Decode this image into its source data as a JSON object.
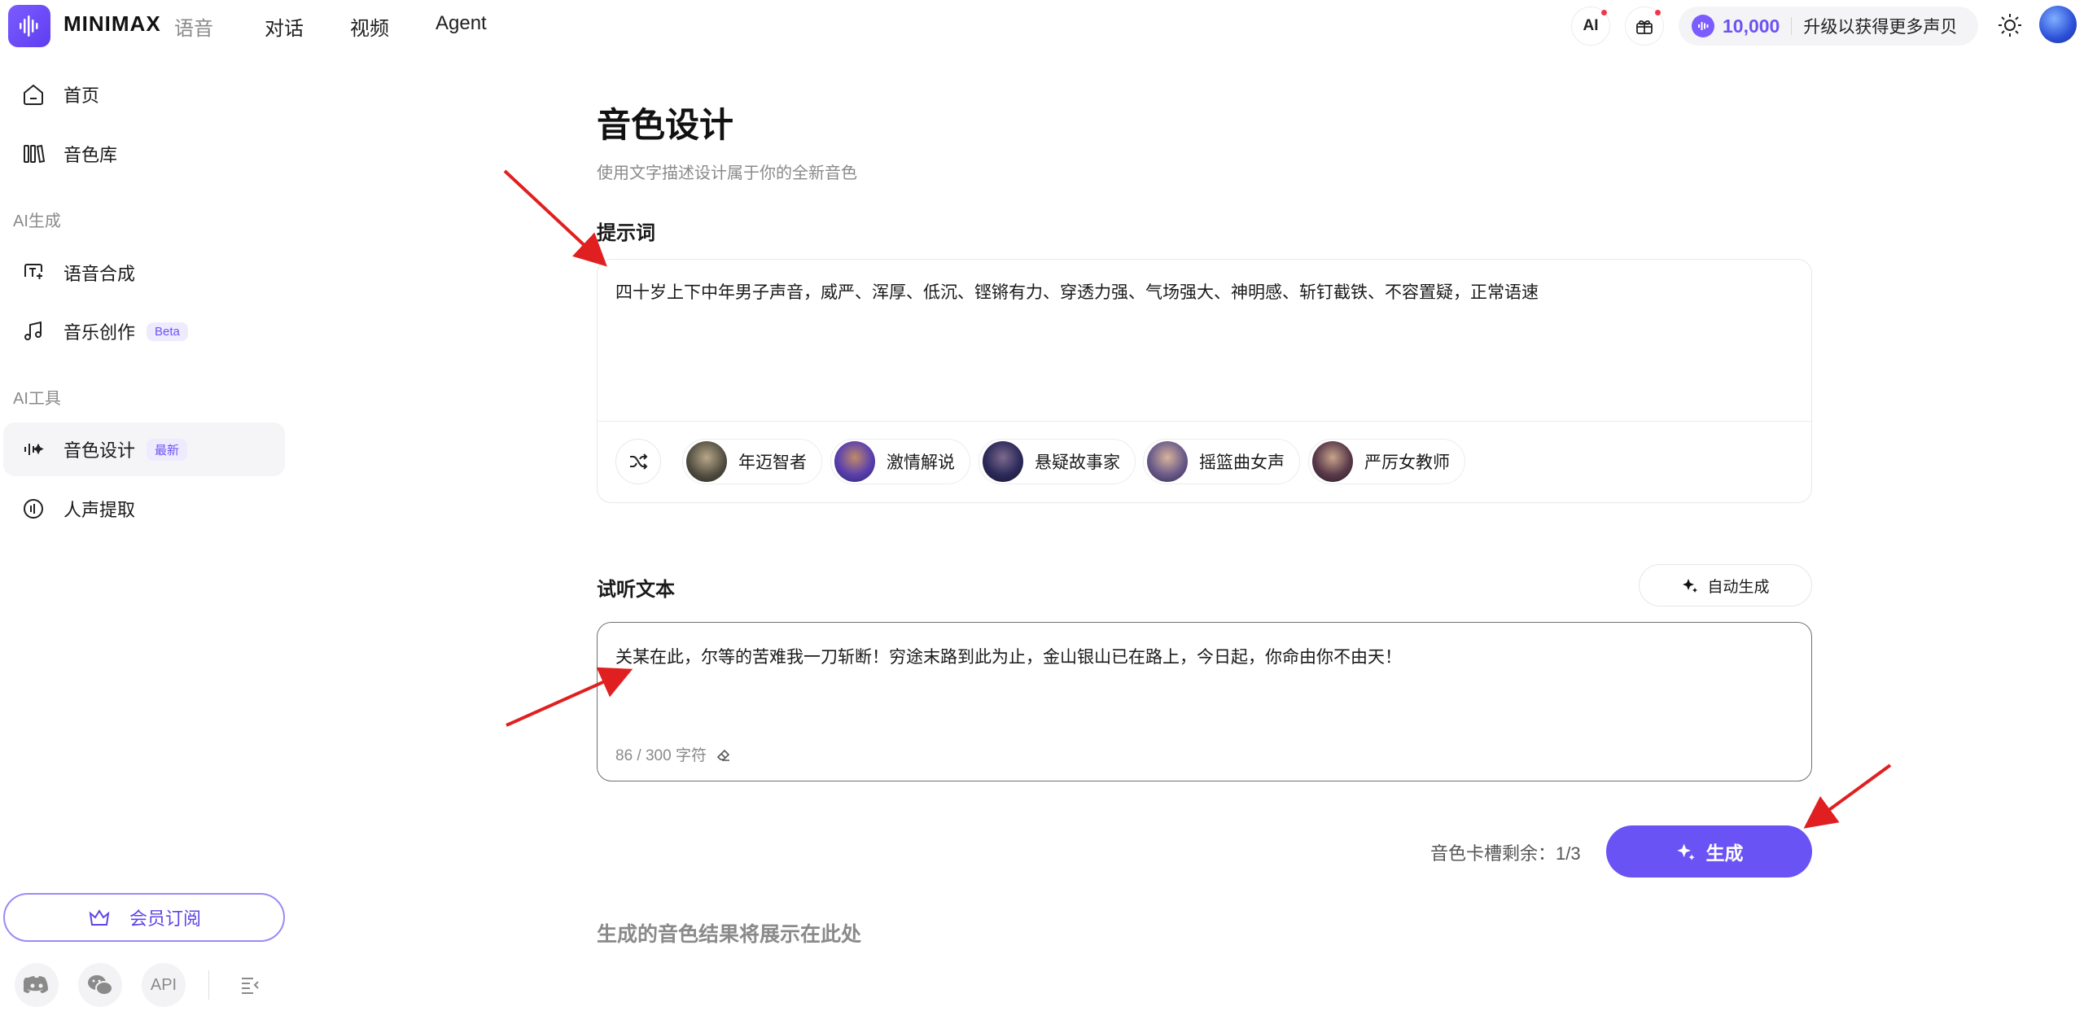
{
  "brand": {
    "name": "MINIMAX",
    "section": "语音"
  },
  "topnav": [
    "对话",
    "视频",
    "Agent"
  ],
  "header": {
    "ai_badge": "AI",
    "credits": "10,000",
    "upgrade": "升级以获得更多声贝"
  },
  "sidebar": {
    "items": [
      {
        "label": "首页",
        "icon": "home-icon"
      },
      {
        "label": "音色库",
        "icon": "library-icon"
      }
    ],
    "section_gen": "AI生成",
    "gen_items": [
      {
        "label": "语音合成",
        "icon": "tts-icon"
      },
      {
        "label": "音乐创作",
        "icon": "music-note-icon",
        "tag": "Beta"
      }
    ],
    "section_tools": "AI工具",
    "tool_items": [
      {
        "label": "音色设计",
        "icon": "voice-design-icon",
        "tag": "最新",
        "active": true
      },
      {
        "label": "人声提取",
        "icon": "voice-extract-icon"
      }
    ],
    "member_label": "会员订阅",
    "footer_api": "API"
  },
  "main": {
    "title": "音色设计",
    "subtitle": "使用文字描述设计属于你的全新音色",
    "prompt_label": "提示词",
    "prompt_value": "四十岁上下中年男子声音，威严、浑厚、低沉、铿锵有力、穿透力强、气场强大、神明感、斩钉截铁、不容置疑，正常语速",
    "presets": [
      "年迈智者",
      "激情解说",
      "悬疑故事家",
      "摇篮曲女声",
      "严厉女教师"
    ],
    "listen_label": "试听文本",
    "auto_label": "自动生成",
    "listen_value": "关某在此，尔等的苦难我一刀斩断！穷途末路到此为止，金山银山已在路上，今日起，你命由你不由天！",
    "char_count": "86 / 300 字符",
    "slot_label": "音色卡槽剩余：",
    "slot_value": "1/3",
    "generate_label": "生成",
    "result_hint": "生成的音色结果将展示在此处"
  },
  "colors": {
    "accent": "#6a53f5",
    "annotation_arrow": "#e02020"
  }
}
